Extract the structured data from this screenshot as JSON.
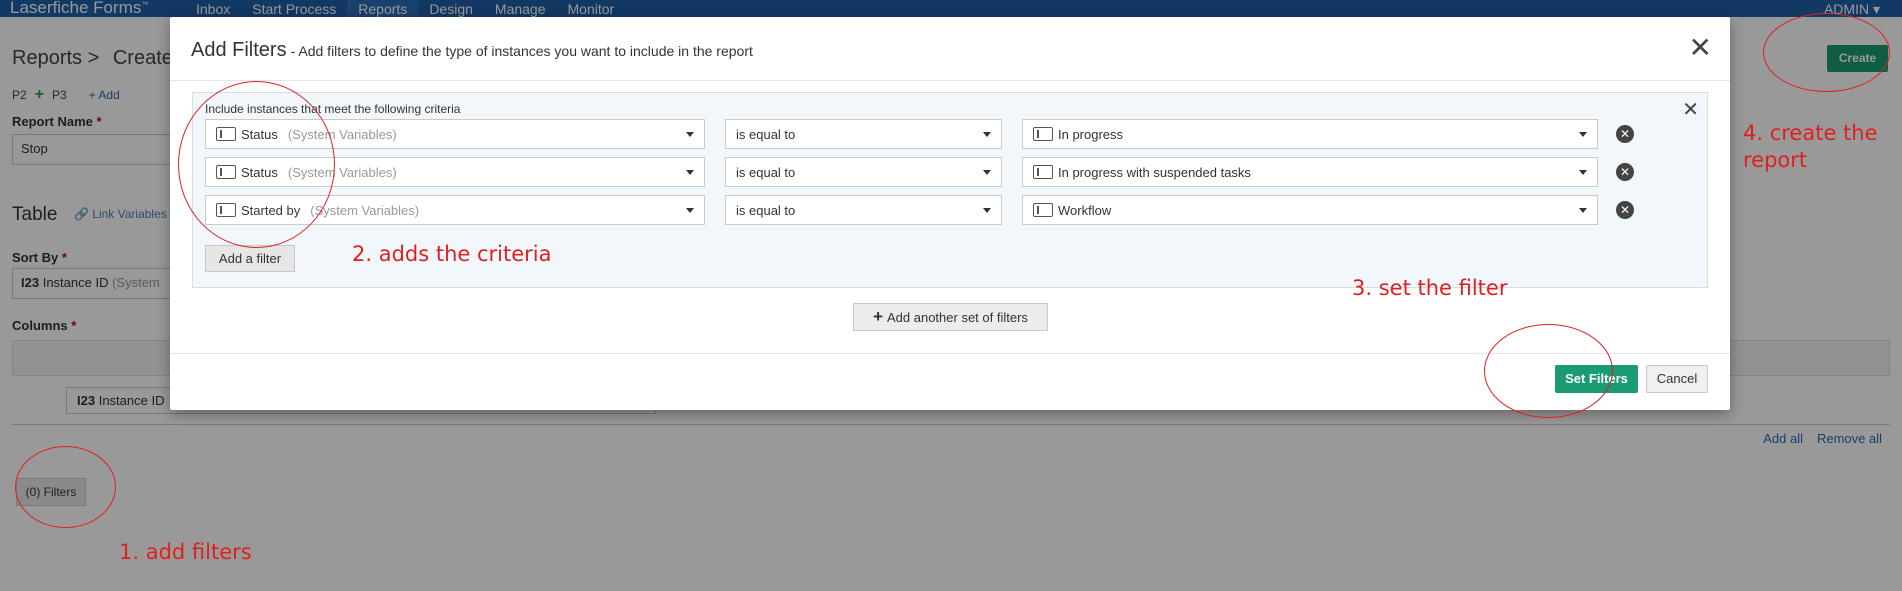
{
  "app": {
    "brand": "Laserfiche Forms",
    "user": "ADMIN"
  },
  "nav": [
    "Inbox",
    "Start Process",
    "Reports",
    "Design",
    "Manage",
    "Monitor"
  ],
  "page": {
    "breadcrumb_root": "Reports",
    "breadcrumb_sep": ">",
    "breadcrumb_current": "Create",
    "pages": [
      "P2",
      "P3"
    ],
    "add_page_label": "+ Add",
    "report_name_label": "Report Name",
    "report_name_value": "Stop",
    "table_title": "Table",
    "link_variables": "Link Variables",
    "sort_by_label": "Sort By",
    "sort_by_value": "Instance ID",
    "sort_by_hint": "(System",
    "columns_label": "Columns",
    "column_chip": "Instance ID",
    "add_all": "Add all",
    "remove_all": "Remove all",
    "filters_button": "(0) Filters",
    "create_button": "Create",
    "required_mark": "*",
    "number_icon": "I23"
  },
  "modal": {
    "title": "Add Filters",
    "subtitle": "- Add filters to define the type of instances you want to include in the report",
    "criteria_header": "Include instances that meet the following criteria",
    "filters": [
      {
        "field": "Status",
        "hint": "(System Variables)",
        "operator": "is equal to",
        "value": "In progress"
      },
      {
        "field": "Status",
        "hint": "(System Variables)",
        "operator": "is equal to",
        "value": "In progress with suspended tasks"
      },
      {
        "field": "Started by",
        "hint": "(System Variables)",
        "operator": "is equal to",
        "value": "Workflow"
      }
    ],
    "add_filter_button": "Add a filter",
    "add_set_button": "Add another set of filters",
    "set_filters_button": "Set Filters",
    "cancel_button": "Cancel",
    "close_glyph": "✕",
    "remove_glyph": "✕"
  },
  "annotations": {
    "step1": "1. add filters",
    "step2": "2. adds the criteria",
    "step3": "3. set the filter",
    "step4_line1": "4. create the",
    "step4_line2": "report",
    "color": "#e02020"
  }
}
